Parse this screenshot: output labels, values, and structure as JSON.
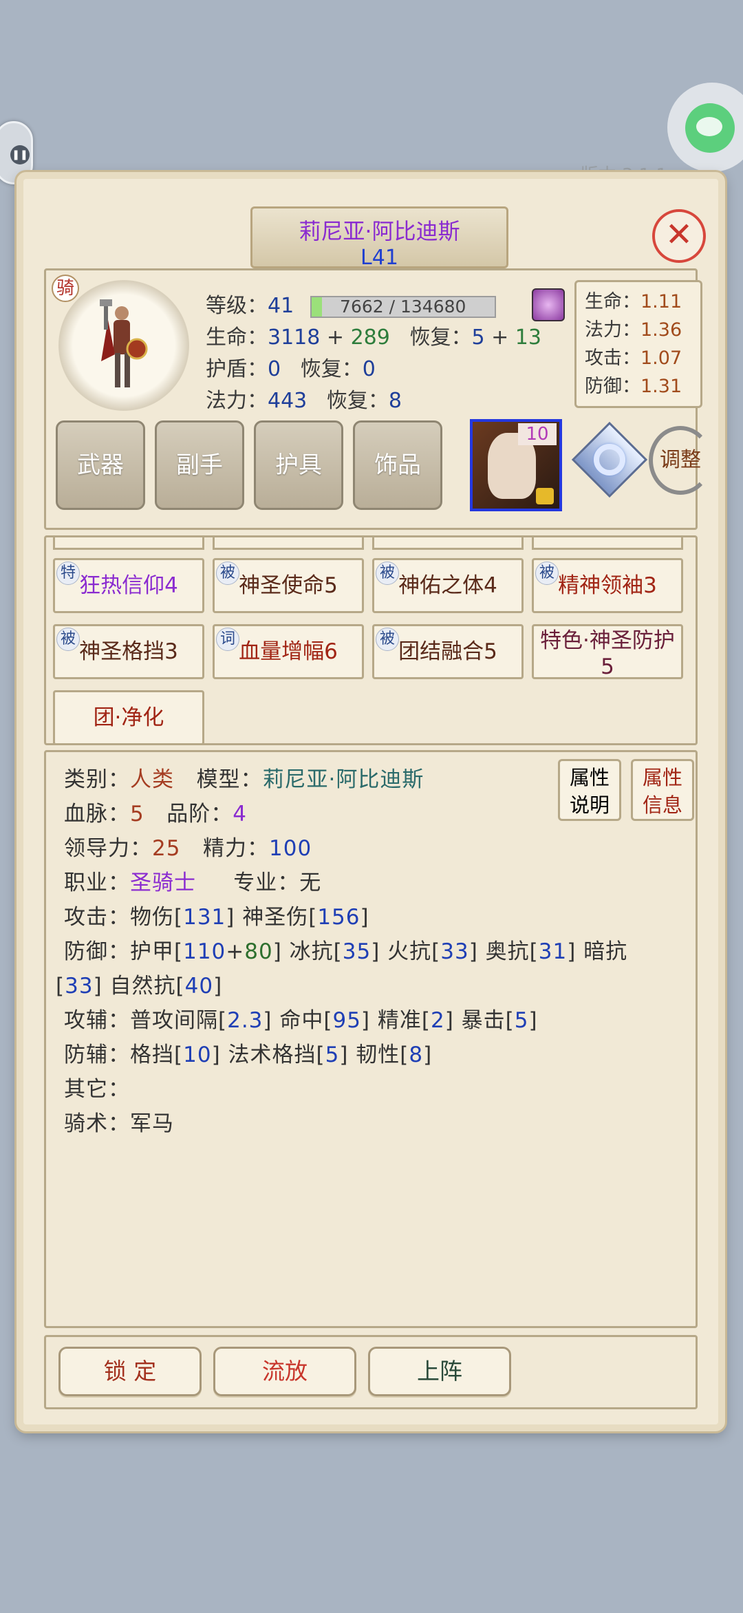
{
  "overlay": {
    "version_text": "版本 3.1.1"
  },
  "title": {
    "name": "莉尼亚·阿比迪斯",
    "level": "L41"
  },
  "close_label": "✕",
  "portrait": {
    "mount_badge": "骑"
  },
  "stats": {
    "level_label": "等级：",
    "level_value": "41",
    "xp_text": "7662 / 134680",
    "xp_fraction": 0.057,
    "hp_label": "生命：",
    "hp_base": "3118",
    "hp_plus": " + ",
    "hp_bonus": "289",
    "hp_regen_label": "恢复：",
    "hp_regen_base": "5",
    "hp_regen_plus": " + ",
    "hp_regen_bonus": "13",
    "shield_label": "护盾：",
    "shield_value": "0",
    "shield_regen_label": "恢复：",
    "shield_regen_value": "0",
    "mana_label": "法力：",
    "mana_value": "443",
    "mana_regen_label": "恢复：",
    "mana_regen_value": "8"
  },
  "multipliers": [
    {
      "label": "生命：",
      "value": "1.11"
    },
    {
      "label": "法力：",
      "value": "1.36"
    },
    {
      "label": "攻击：",
      "value": "1.07"
    },
    {
      "label": "防御：",
      "value": "1.31"
    }
  ],
  "equipment": {
    "weapon": "武器",
    "offhand": "副手",
    "armor": "护具",
    "accessory": "饰品",
    "mount_level": "10",
    "adjust": "调整"
  },
  "skills": [
    {
      "tag": "特",
      "name": "狂热信仰4"
    },
    {
      "tag": "被",
      "name": "神圣使命5"
    },
    {
      "tag": "被",
      "name": "神佑之体4"
    },
    {
      "tag": "被",
      "name": "精神领袖3"
    },
    {
      "tag": "被",
      "name": "神圣格挡3"
    },
    {
      "tag": "词",
      "name": "血量增幅6"
    },
    {
      "tag": "被",
      "name": "团结融合5"
    },
    {
      "tag": "",
      "name": "特色·神圣防护",
      "name2": "5"
    },
    {
      "tag": "",
      "name": "团·净化"
    }
  ],
  "attributes": {
    "category_label": "类别：",
    "category_value": "人类",
    "model_label": "模型：",
    "model_value": "莉尼亚·阿比迪斯",
    "bloodline_label": "血脉：",
    "bloodline_value": "5",
    "grade_label": "品阶：",
    "grade_value": "4",
    "leadership_label": "领导力：",
    "leadership_value": "25",
    "energy_label": "精力：",
    "energy_value": "100",
    "class_label": "职业：",
    "class_value": "圣骑士",
    "profession_label": "专业：",
    "profession_value": "无",
    "attack_label": "攻击：",
    "phys_label": "物伤[",
    "phys_value": "131",
    "holy_label": "] 神圣伤[",
    "holy_value": "156",
    "attack_end": "]",
    "defense_label": "防御：",
    "armor_label": "护甲[",
    "armor_base": "110",
    "armor_plus": "+",
    "armor_bonus": "80",
    "ice_label": "] 冰抗[",
    "ice_value": "35",
    "fire_label": "] 火抗[",
    "fire_value": "33",
    "arcane_label": "] 奥抗[",
    "arcane_value": "31",
    "dark_label": "] 暗抗",
    "dark_open": "[",
    "dark_value": "33",
    "nature_label": "] 自然抗[",
    "nature_value": "40",
    "defense_end": "]",
    "atk_aux_label": "攻辅：",
    "interval_label": "普攻间隔[",
    "interval_value": "2.3",
    "hit_label": "] 命中[",
    "hit_value": "95",
    "precision_label": "] 精准[",
    "precision_value": "2",
    "crit_label": "] 暴击[",
    "crit_value": "5",
    "atk_aux_end": "]",
    "def_aux_label": "防辅：",
    "block_label": "格挡[",
    "block_value": "10",
    "spell_block_label": "] 法术格挡[",
    "spell_block_value": "5",
    "toughness_label": "] 韧性[",
    "toughness_value": "8",
    "def_aux_end": "]",
    "other_label": "其它：",
    "riding_label": "骑术：",
    "riding_value": "军马",
    "btn_explain_1": "属性",
    "btn_explain_2": "说明",
    "btn_info_1": "属性",
    "btn_info_2": "信息"
  },
  "actions": {
    "lock": "锁 定",
    "exile": "流放",
    "deploy": "上阵"
  }
}
